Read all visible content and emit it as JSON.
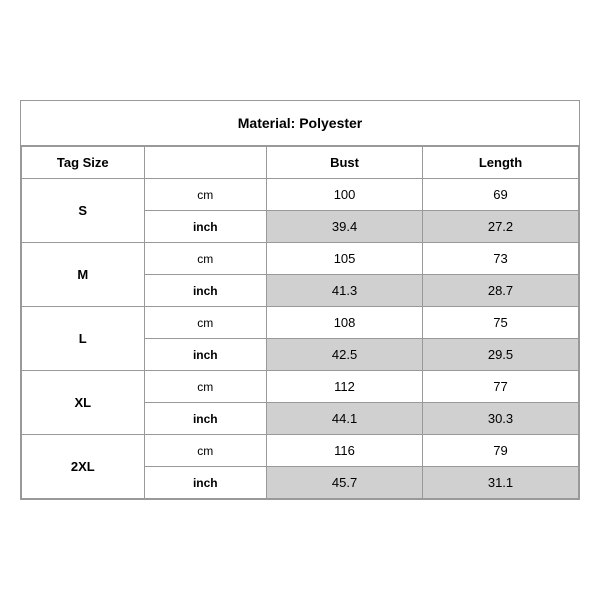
{
  "title": "Material: Polyester",
  "headers": {
    "tag_size": "Tag Size",
    "bust": "Bust",
    "length": "Length"
  },
  "sizes": [
    {
      "label": "S",
      "cm": {
        "bust": "100",
        "length": "69"
      },
      "inch": {
        "bust": "39.4",
        "length": "27.2"
      }
    },
    {
      "label": "M",
      "cm": {
        "bust": "105",
        "length": "73"
      },
      "inch": {
        "bust": "41.3",
        "length": "28.7"
      }
    },
    {
      "label": "L",
      "cm": {
        "bust": "108",
        "length": "75"
      },
      "inch": {
        "bust": "42.5",
        "length": "29.5"
      }
    },
    {
      "label": "XL",
      "cm": {
        "bust": "112",
        "length": "77"
      },
      "inch": {
        "bust": "44.1",
        "length": "30.3"
      }
    },
    {
      "label": "2XL",
      "cm": {
        "bust": "116",
        "length": "79"
      },
      "inch": {
        "bust": "45.7",
        "length": "31.1"
      }
    }
  ],
  "units": {
    "cm": "cm",
    "inch": "inch"
  }
}
